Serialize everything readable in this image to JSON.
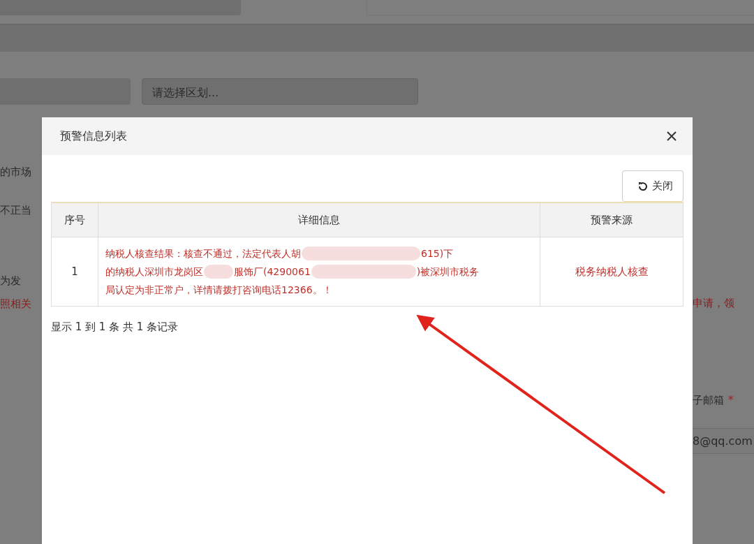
{
  "background": {
    "region_select": {
      "placeholder": "请选择区划..."
    },
    "left_fragments": [
      {
        "kind": "normal",
        "text": "的市场"
      },
      {
        "kind": "normal",
        "text": "不正当"
      },
      {
        "kind": "normal",
        "text": "为发"
      },
      {
        "kind": "warning",
        "text": "照相关"
      }
    ],
    "right_fragments": [
      {
        "kind": "warning",
        "text": "申请，领"
      }
    ],
    "email_label": "子邮箱",
    "required_mark": "*",
    "email_value": "8@qq.com"
  },
  "dialog": {
    "title": "预警信息列表",
    "close_button": "关闭",
    "table": {
      "columns": [
        "序号",
        "详细信息",
        "预警来源"
      ],
      "rows": [
        {
          "index": "1",
          "source": "税务纳税人核查",
          "detail": [
            [
              {
                "kind": "text",
                "text": "纳税人核查结果：核查不通过，法定代表人胡"
              },
              {
                "kind": "redacted"
              },
              {
                "kind": "text",
                "text": "615)下"
              }
            ],
            [
              {
                "kind": "text",
                "text": "的纳税人深圳市龙岗区"
              },
              {
                "kind": "redacted"
              },
              {
                "kind": "text",
                "text": "服饰厂(4290061"
              },
              {
                "kind": "redacted"
              },
              {
                "kind": "text",
                "text": ")被深圳市税务"
              }
            ],
            [
              {
                "kind": "text",
                "text": "局认定为非正常户，详情请拨打咨询电话12366。！"
              }
            ]
          ]
        }
      ]
    },
    "pagination": "显示 1 到 1 条 共 1 条记录"
  }
}
